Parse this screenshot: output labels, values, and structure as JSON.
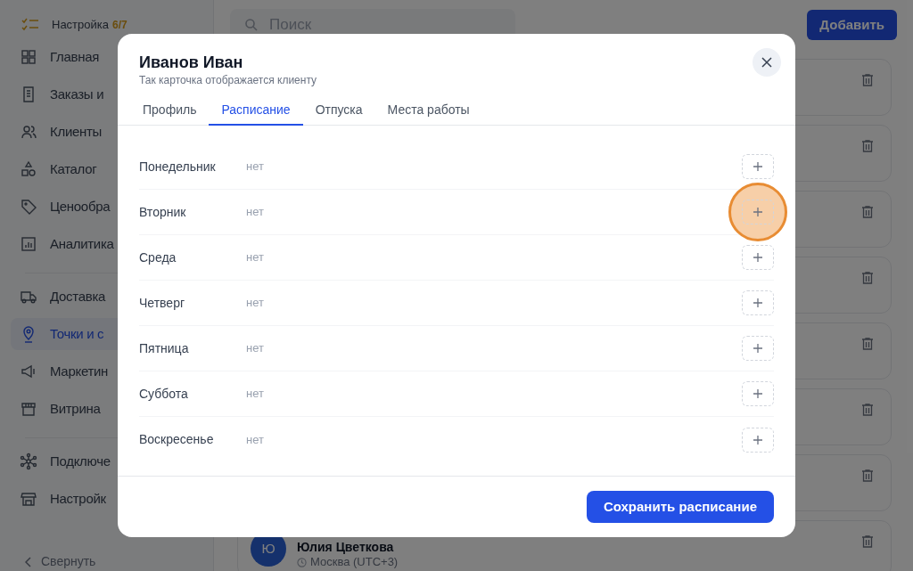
{
  "sidebar": {
    "setup": {
      "label": "Настройка",
      "progress": "6/7"
    },
    "groups": [
      [
        {
          "label": "Главная",
          "selected": false
        },
        {
          "label": "Заказы и",
          "selected": false
        },
        {
          "label": "Клиенты",
          "selected": false
        },
        {
          "label": "Каталог",
          "selected": false
        },
        {
          "label": "Ценообра",
          "selected": false
        },
        {
          "label": "Аналитика",
          "selected": false
        }
      ],
      [
        {
          "label": "Доставка",
          "selected": false
        },
        {
          "label": "Точки и с",
          "selected": true
        },
        {
          "label": "Маркетин",
          "selected": false
        },
        {
          "label": "Витрина",
          "selected": false
        }
      ],
      [
        {
          "label": "Подключе",
          "selected": false
        },
        {
          "label": "Настройк",
          "selected": false
        }
      ]
    ],
    "collapse": "Свернуть"
  },
  "search": {
    "placeholder": "Поиск"
  },
  "add_button": "Добавить",
  "cards": [
    {
      "avatar": "Ю",
      "name": "Юлия Цветкова",
      "location": "Москва (UTC+3)"
    }
  ],
  "modal": {
    "title": "Иванов Иван",
    "subtitle": "Так карточка отображается клиенту",
    "tabs": [
      {
        "label": "Профиль",
        "selected": false
      },
      {
        "label": "Расписание",
        "selected": true
      },
      {
        "label": "Отпуска",
        "selected": false
      },
      {
        "label": "Места работы",
        "selected": false
      }
    ],
    "days": [
      {
        "day": "Понедельник",
        "value": "нет",
        "highlighted": false
      },
      {
        "day": "Вторник",
        "value": "нет",
        "highlighted": true
      },
      {
        "day": "Среда",
        "value": "нет",
        "highlighted": false
      },
      {
        "day": "Четверг",
        "value": "нет",
        "highlighted": false
      },
      {
        "day": "Пятница",
        "value": "нет",
        "highlighted": false
      },
      {
        "day": "Суббота",
        "value": "нет",
        "highlighted": false
      },
      {
        "day": "Воскресенье",
        "value": "нет",
        "highlighted": false
      }
    ],
    "save_button": "Сохранить расписание"
  }
}
